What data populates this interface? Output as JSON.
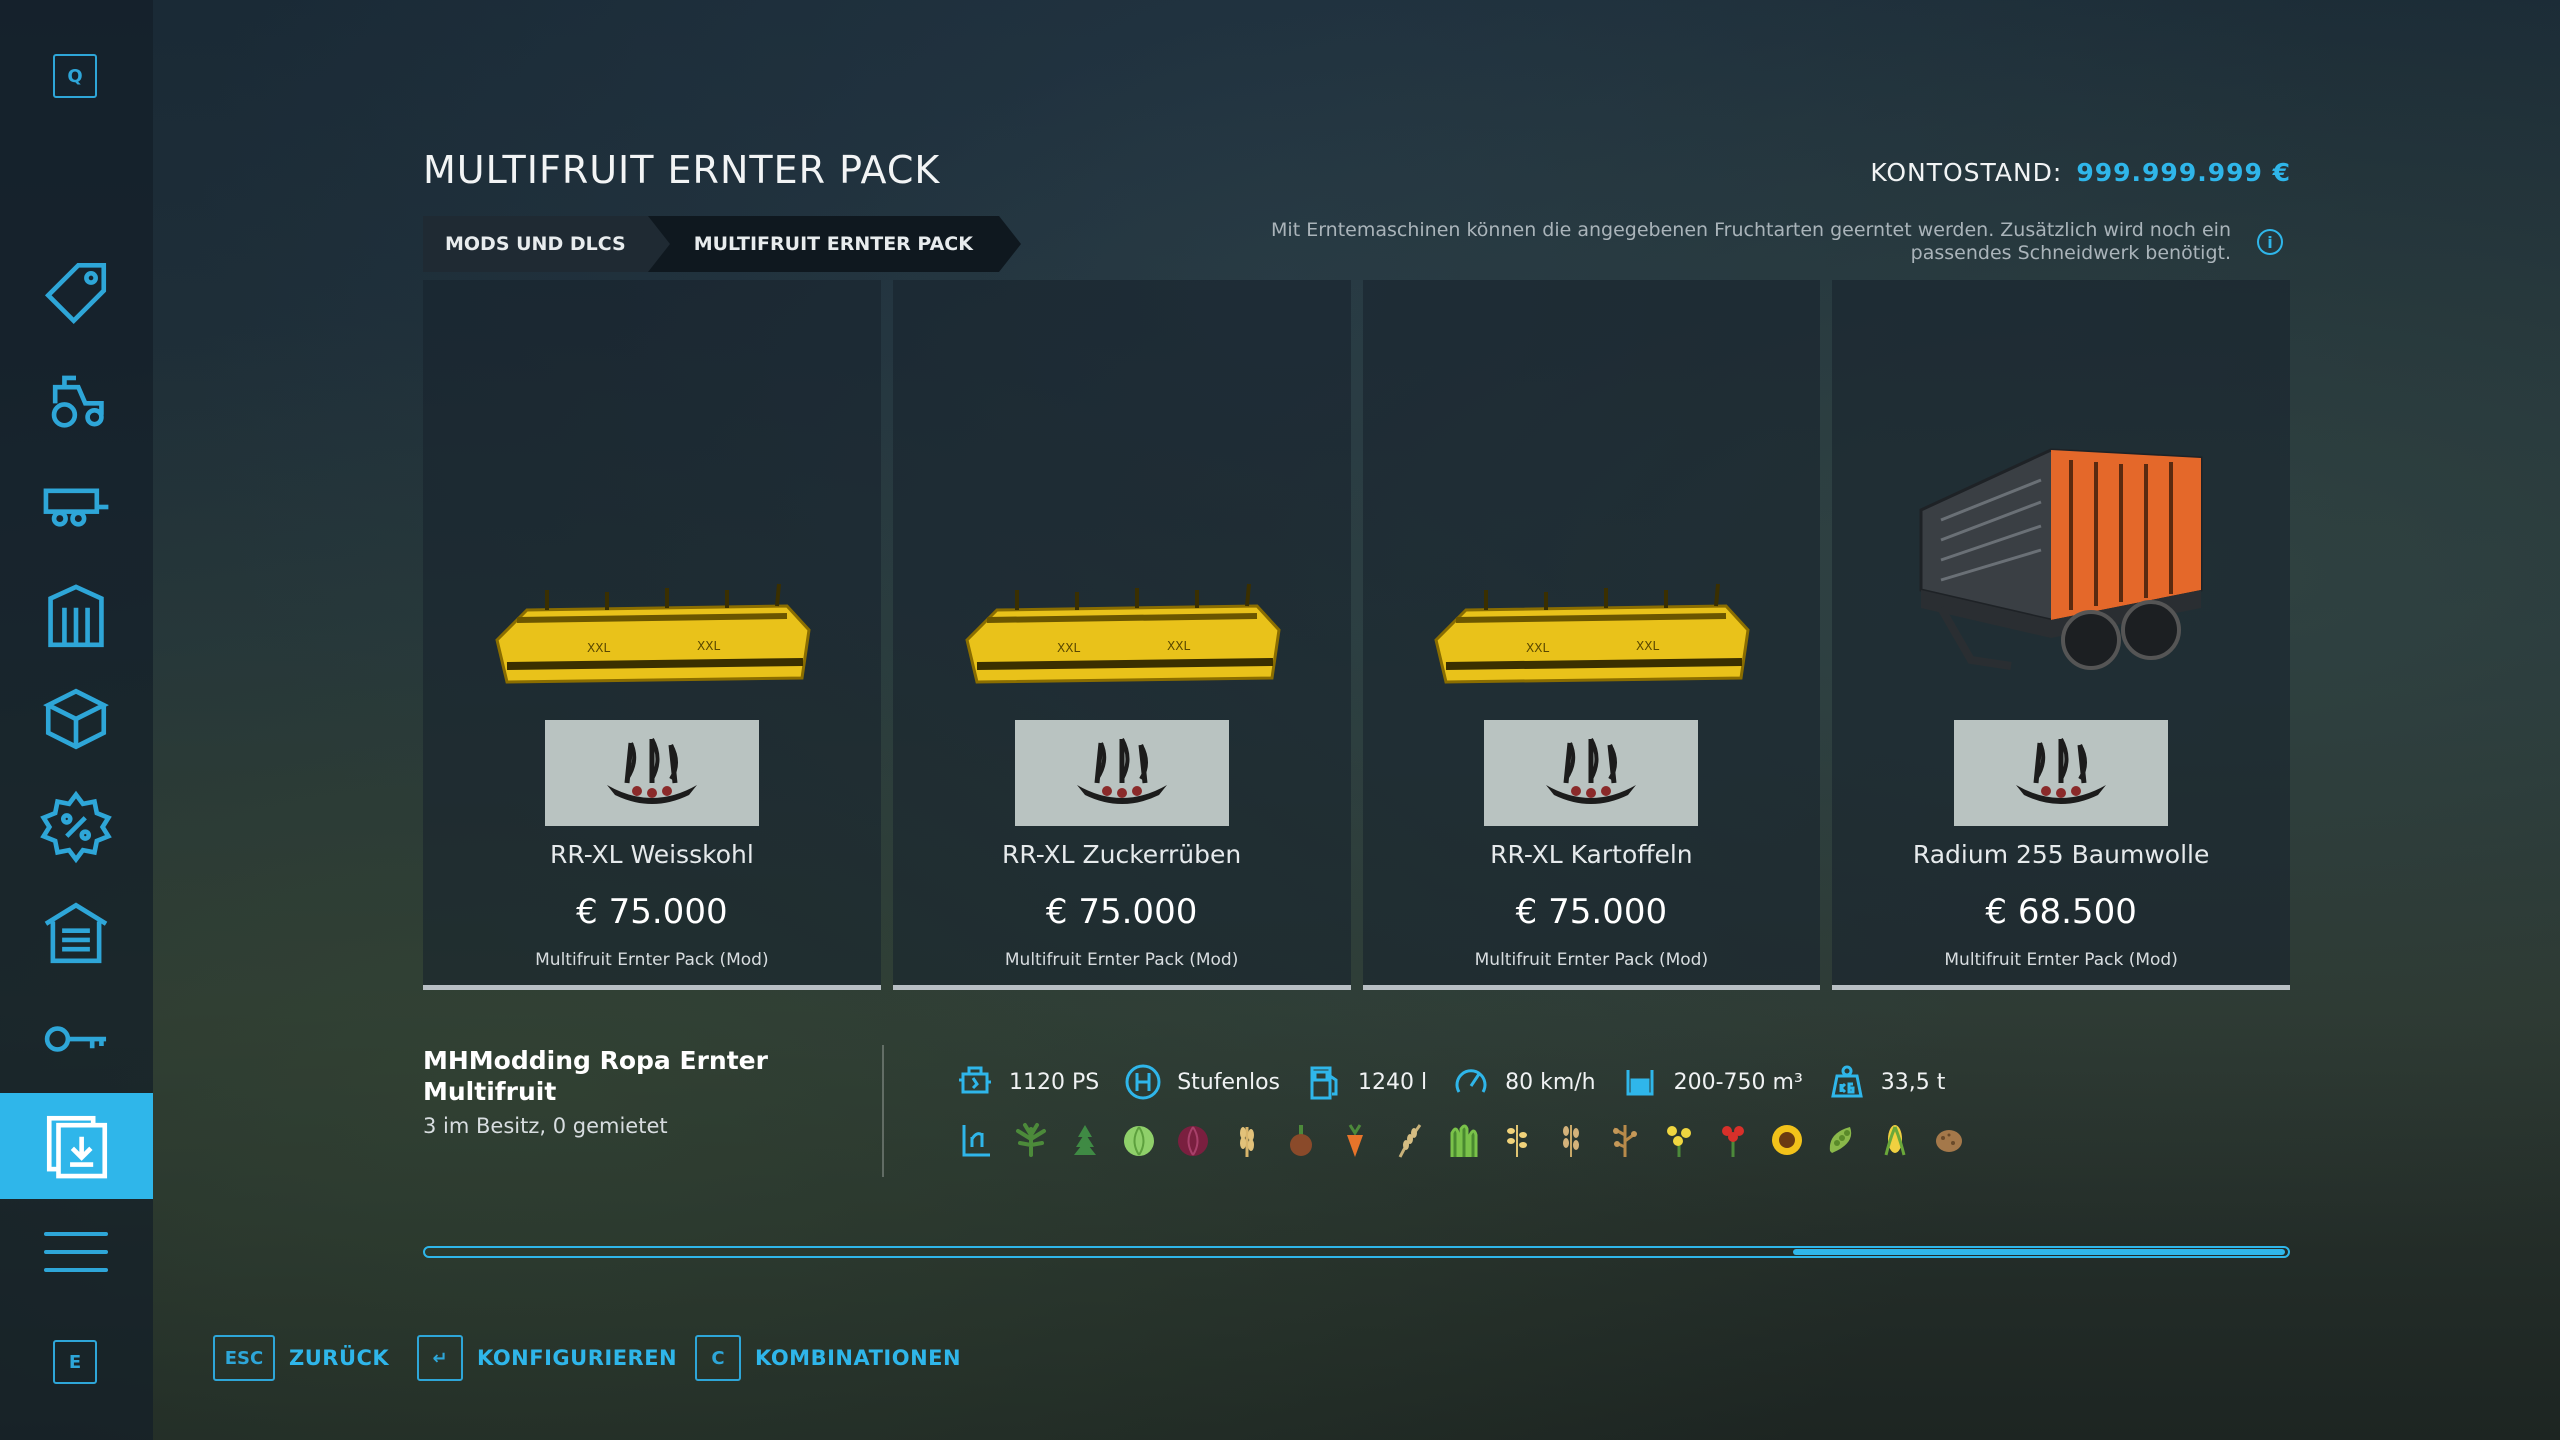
{
  "sidebar": {
    "top_key": "Q",
    "bottom_key": "E",
    "items": [
      {
        "icon": "price-tag-icon"
      },
      {
        "icon": "tractor-icon"
      },
      {
        "icon": "trailer-icon"
      },
      {
        "icon": "silo-icon"
      },
      {
        "icon": "box-icon"
      },
      {
        "icon": "discount-badge-icon"
      },
      {
        "icon": "shed-icon"
      },
      {
        "icon": "key-icon"
      },
      {
        "icon": "download-mods-icon",
        "active": true
      },
      {
        "icon": "menu-icon"
      }
    ]
  },
  "header": {
    "title": "MULTIFRUIT ERNTER PACK",
    "balance_label": "KONTOSTAND:",
    "balance_value": "999.999.999 €"
  },
  "breadcrumb": [
    "MODS UND DLCS",
    "MULTIFRUIT ERNTER PACK"
  ],
  "info_text": "Mit Erntemaschinen können die angegebenen Fruchtarten geerntet werden. Zusätzlich wird noch ein passendes Schneidwerk benötigt.",
  "cards": [
    {
      "name": "RR-XL Weisskohl",
      "price": "€ 75.000",
      "source": "Multifruit Ernter Pack (Mod)",
      "kind": "harvester"
    },
    {
      "name": "RR-XL Zuckerrüben",
      "price": "€ 75.000",
      "source": "Multifruit Ernter Pack (Mod)",
      "kind": "harvester"
    },
    {
      "name": "RR-XL Kartoffeln",
      "price": "€ 75.000",
      "source": "Multifruit Ernter Pack (Mod)",
      "kind": "harvester"
    },
    {
      "name": "Radium 255 Baumwolle",
      "price": "€ 68.500",
      "source": "Multifruit Ernter Pack (Mod)",
      "kind": "trailer"
    }
  ],
  "details": {
    "title": "MHModding Ropa Ernter Multifruit",
    "owned": "3 im Besitz, 0 gemietet",
    "specs": [
      {
        "icon": "engine-icon",
        "value": "1120 PS"
      },
      {
        "icon": "transmission-icon",
        "value": "Stufenlos"
      },
      {
        "icon": "fuel-icon",
        "value": "1240 l"
      },
      {
        "icon": "speed-icon",
        "value": "80 km/h"
      },
      {
        "icon": "capacity-icon",
        "value": "200-750 m³"
      },
      {
        "icon": "weight-icon",
        "value": "33,5 t"
      }
    ],
    "fruits": [
      "harvester-type-icon",
      "hemp-icon",
      "herb-icon",
      "cabbage-icon",
      "red-cabbage-icon",
      "wheat-icon",
      "onion-icon",
      "carrot-icon",
      "barley-icon",
      "grass-icon",
      "oat-icon",
      "rye-icon",
      "soybean-icon",
      "canola-icon",
      "poppy-icon",
      "sunflower-icon",
      "pea-icon",
      "corn-icon",
      "potato-icon"
    ]
  },
  "scroll": {
    "position_fraction": 0.75,
    "thumb_fraction": 0.27
  },
  "footer": [
    {
      "key": "ESC",
      "label": "ZURÜCK"
    },
    {
      "key": "↵",
      "label": "KONFIGURIEREN"
    },
    {
      "key": "C",
      "label": "KOMBINATIONEN"
    }
  ],
  "colors": {
    "accent": "#2fb6ea",
    "harvester": "#e9c21a",
    "trailer": "#e4682a"
  }
}
